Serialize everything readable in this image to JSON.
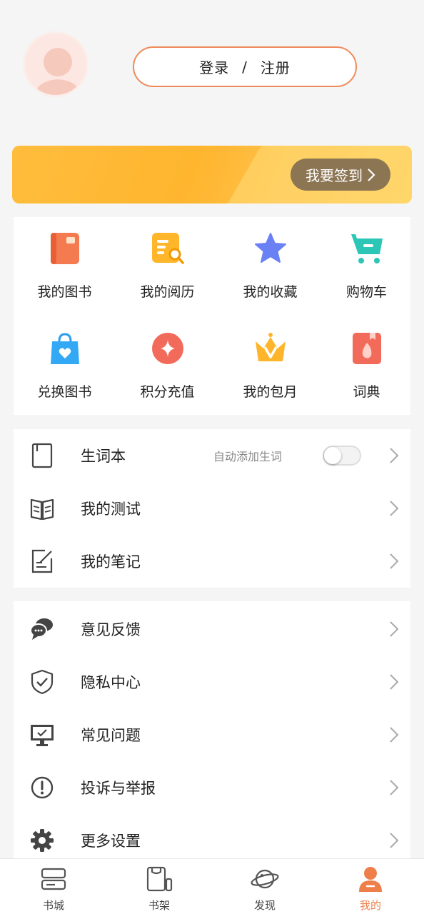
{
  "profile": {
    "login_label": "登录",
    "separator": "/",
    "register_label": "注册"
  },
  "banner": {
    "signin_label": "我要签到",
    "color": "#ffb52e"
  },
  "grid": [
    {
      "label": "我的图书",
      "icon": "book-icon"
    },
    {
      "label": "我的阅历",
      "icon": "reading-history-icon"
    },
    {
      "label": "我的收藏",
      "icon": "star-icon"
    },
    {
      "label": "购物车",
      "icon": "cart-icon"
    },
    {
      "label": "兑换图书",
      "icon": "shopping-bag-icon"
    },
    {
      "label": "积分充值",
      "icon": "points-icon"
    },
    {
      "label": "我的包月",
      "icon": "crown-icon"
    },
    {
      "label": "词典",
      "icon": "dictionary-icon"
    }
  ],
  "list1": [
    {
      "label": "生词本",
      "hint": "自动添加生词",
      "toggle_on": false,
      "icon": "notebook-icon"
    },
    {
      "label": "我的测试",
      "icon": "open-book-icon"
    },
    {
      "label": "我的笔记",
      "icon": "note-edit-icon"
    }
  ],
  "list2": [
    {
      "label": "意见反馈",
      "icon": "chat-bubbles-icon"
    },
    {
      "label": "隐私中心",
      "icon": "shield-check-icon"
    },
    {
      "label": "常见问题",
      "icon": "monitor-check-icon"
    },
    {
      "label": "投诉与举报",
      "icon": "exclamation-circle-icon"
    },
    {
      "label": "更多设置",
      "icon": "gear-icon"
    }
  ],
  "tabs": [
    {
      "label": "书城",
      "icon": "bookstore-icon",
      "active": false
    },
    {
      "label": "书架",
      "icon": "bookshelf-icon",
      "active": false
    },
    {
      "label": "发现",
      "icon": "planet-icon",
      "active": false
    },
    {
      "label": "我的",
      "icon": "user-icon",
      "active": true
    }
  ],
  "colors": {
    "accent": "#ef7f4a",
    "background": "#f5f5f5"
  }
}
